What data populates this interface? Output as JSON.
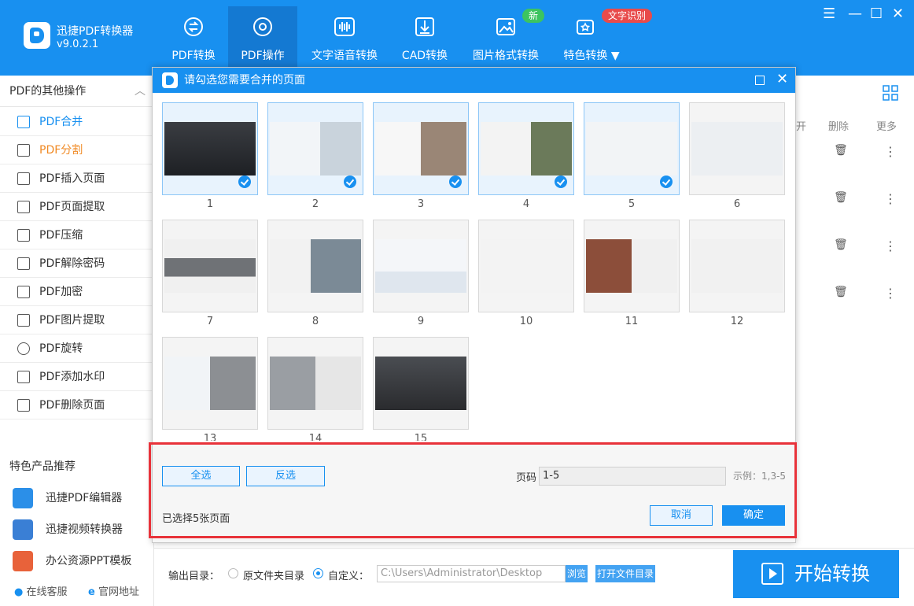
{
  "app": {
    "name": "迅捷PDF转换器",
    "version": "v9.0.2.1"
  },
  "tabs": [
    {
      "label": "PDF转换"
    },
    {
      "label": "PDF操作"
    },
    {
      "label": "文字语音转换"
    },
    {
      "label": "CAD转换"
    },
    {
      "label": "图片格式转换"
    },
    {
      "label": "特色转换 ▼"
    }
  ],
  "badges": {
    "new": "新",
    "ocr": "文字识别"
  },
  "window": {
    "menu": "☰",
    "min": "—",
    "max": "☐",
    "close": "✕"
  },
  "sidebar": {
    "header": "PDF的其他操作",
    "collapse": "︿",
    "items": [
      {
        "label": "PDF合并"
      },
      {
        "label": "PDF分割"
      },
      {
        "label": "PDF插入页面"
      },
      {
        "label": "PDF页面提取"
      },
      {
        "label": "PDF压缩"
      },
      {
        "label": "PDF解除密码"
      },
      {
        "label": "PDF加密"
      },
      {
        "label": "PDF图片提取"
      },
      {
        "label": "PDF旋转"
      },
      {
        "label": "PDF添加水印"
      },
      {
        "label": "PDF删除页面"
      }
    ],
    "featured_title": "特色产品推荐",
    "products": [
      {
        "label": "迅捷PDF编辑器"
      },
      {
        "label": "迅捷视频转换器"
      },
      {
        "label": "办公资源PPT模板"
      }
    ],
    "footer": {
      "support": "在线客服",
      "website": "官网地址"
    }
  },
  "right_panel": {
    "col_open": "开",
    "col_delete": "删除",
    "col_more": "更多",
    "more_icon": "⋮",
    "trash_icon": "🗑"
  },
  "dialog": {
    "title": "请勾选您需要合并的页面",
    "pages": [
      {
        "num": "1",
        "selected": true
      },
      {
        "num": "2",
        "selected": true
      },
      {
        "num": "3",
        "selected": true
      },
      {
        "num": "4",
        "selected": true
      },
      {
        "num": "5",
        "selected": true
      },
      {
        "num": "6",
        "selected": false
      },
      {
        "num": "7",
        "selected": false
      },
      {
        "num": "8",
        "selected": false
      },
      {
        "num": "9",
        "selected": false
      },
      {
        "num": "10",
        "selected": false
      },
      {
        "num": "11",
        "selected": false
      },
      {
        "num": "12",
        "selected": false
      },
      {
        "num": "13",
        "selected": false
      },
      {
        "num": "14",
        "selected": false
      },
      {
        "num": "15",
        "selected": false
      }
    ],
    "select_all": "全选",
    "invert": "反选",
    "page_label": "页码",
    "page_value": "1-5",
    "example": "示例：1,3-5",
    "selected_count": "已选择5张页面",
    "cancel": "取消",
    "confirm": "确定"
  },
  "output": {
    "label": "输出目录：",
    "opt_source": "原文件夹目录",
    "opt_custom": "自定义：",
    "path": "C:\\Users\\Administrator\\Desktop",
    "browse": "浏览",
    "open_dir": "打开文件目录"
  },
  "start_button": "开始转换",
  "colors": {
    "brand": "#1890f0",
    "highlight_frame": "#e8323a",
    "orange": "#f08a24"
  }
}
